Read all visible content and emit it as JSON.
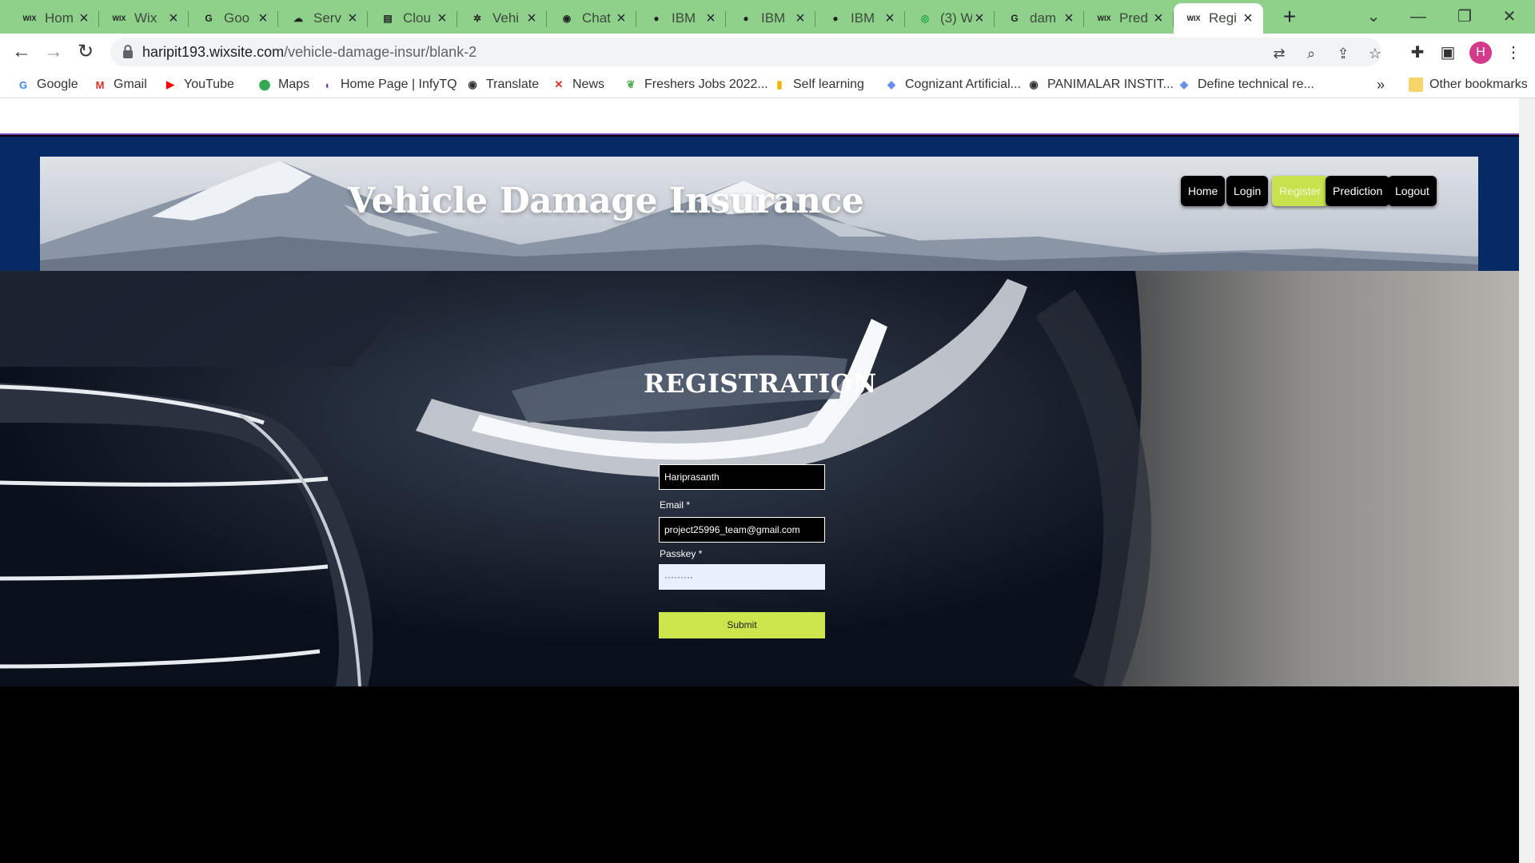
{
  "browser": {
    "tabs": [
      {
        "favicon": "wix-icon",
        "title": "Hom",
        "active": false
      },
      {
        "favicon": "wix-icon",
        "title": "Wix",
        "active": false
      },
      {
        "favicon": "google-icon",
        "title": "Goo",
        "active": false
      },
      {
        "favicon": "cloud-icon",
        "title": "Serv",
        "active": false
      },
      {
        "favicon": "document-icon",
        "title": "Clou",
        "active": false
      },
      {
        "favicon": "bug-icon",
        "title": "Vehi",
        "active": false
      },
      {
        "favicon": "globe-icon",
        "title": "Chat",
        "active": false
      },
      {
        "favicon": "github-icon",
        "title": "IBM",
        "active": false
      },
      {
        "favicon": "github-icon",
        "title": "IBM",
        "active": false
      },
      {
        "favicon": "github-icon",
        "title": "IBM",
        "active": false
      },
      {
        "favicon": "whatsapp-icon",
        "title": "(3) W",
        "active": false
      },
      {
        "favicon": "google-icon",
        "title": "dam",
        "active": false
      },
      {
        "favicon": "wix-icon",
        "title": "Pred",
        "active": false
      },
      {
        "favicon": "wix-icon",
        "title": "Regi",
        "active": true
      }
    ],
    "url_host": "haripit193.wixsite.com",
    "url_path": "/vehicle-damage-insur/blank-2",
    "avatar_letter": "H",
    "bookmarks": [
      {
        "icon": "google-icon",
        "label": "Google"
      },
      {
        "icon": "gmail-icon",
        "label": "Gmail"
      },
      {
        "icon": "youtube-icon",
        "label": "YouTube"
      },
      {
        "icon": "maps-icon",
        "label": "Maps"
      },
      {
        "icon": "infytq-icon",
        "label": "Home Page | InfyTQ"
      },
      {
        "icon": "globe-icon",
        "label": "Translate"
      },
      {
        "icon": "news-icon",
        "label": "News"
      },
      {
        "icon": "leaf-icon",
        "label": "Freshers Jobs 2022..."
      },
      {
        "icon": "bar-icon",
        "label": "Self learning"
      },
      {
        "icon": "gem-icon",
        "label": "Cognizant Artificial..."
      },
      {
        "icon": "globe-icon",
        "label": "PANIMALAR INSTIT..."
      },
      {
        "icon": "gem-icon",
        "label": "Define technical re..."
      }
    ],
    "bookmarks_more": "»",
    "other_bookmarks": "Other bookmarks"
  },
  "site": {
    "title": "Vehicle Damage Insurance",
    "nav": [
      {
        "label": "Home",
        "active": false
      },
      {
        "label": "Login",
        "active": false
      },
      {
        "label": "Register",
        "active": true
      },
      {
        "label": "Prediction",
        "active": false
      },
      {
        "label": "Logout",
        "active": false
      }
    ]
  },
  "form": {
    "heading": "REGISTRATION",
    "name_value": "Hariprasanth",
    "email_label": "Email *",
    "email_value": "project25996_team@gmail.com",
    "passkey_label": "Passkey *",
    "passkey_value": "·········",
    "submit_label": "Submit"
  },
  "colors": {
    "tabstrip": "#8fd18a",
    "header_blue": "#052a66",
    "accent": "#cde54c",
    "avatar": "#d33a8a"
  }
}
